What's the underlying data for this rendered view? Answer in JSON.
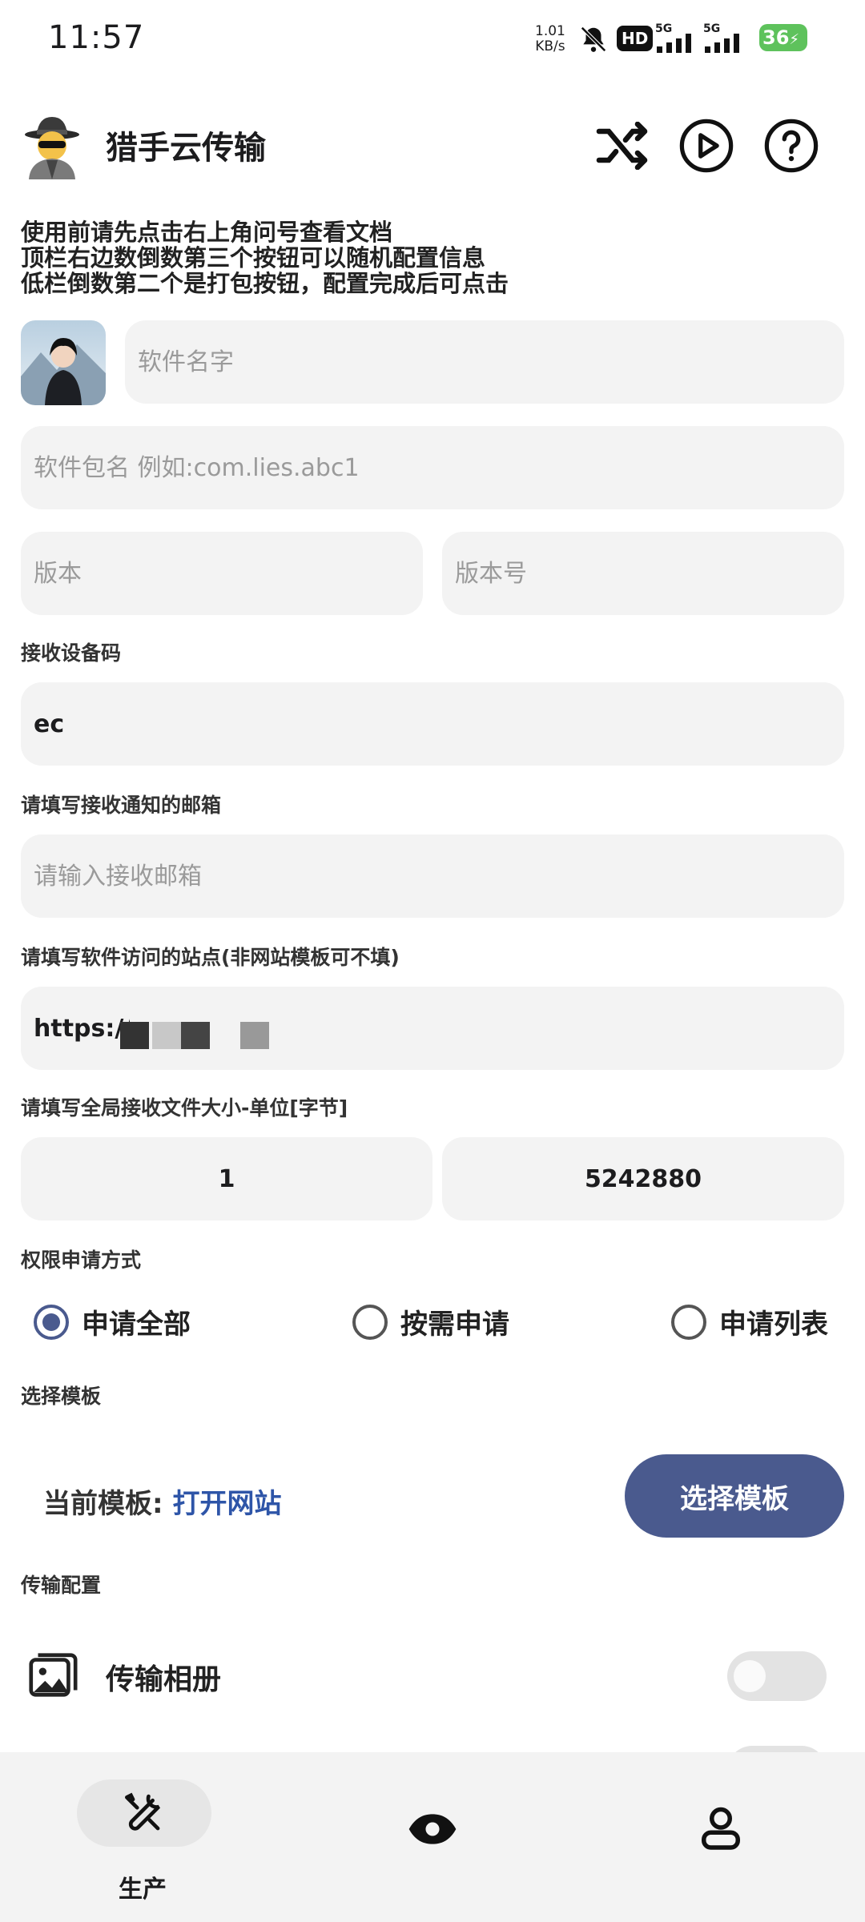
{
  "status": {
    "time": "11:57",
    "net_speed": "1.01",
    "net_unit": "KB/s",
    "hd": "HD",
    "signal1": "5G",
    "signal2": "5G",
    "battery": "36"
  },
  "header": {
    "app_title": "猎手云传输",
    "icons": [
      "spy-avatar-icon",
      "shuffle-icon",
      "play-icon",
      "help-icon"
    ]
  },
  "intro_lines": [
    "使用前请先点击右上角问号查看文档",
    "顶栏右边数倒数第三个按钮可以随机配置信息",
    "低栏倒数第二个是打包按钮，配置完成后可点击"
  ],
  "form": {
    "app_name_placeholder": "软件名字",
    "package_placeholder": "软件包名 例如:com.lies.abc1",
    "version_placeholder": "版本",
    "version_code_placeholder": "版本号",
    "device_code_label": "接收设备码",
    "device_code_value": "ec",
    "email_label": "请填写接收通知的邮箱",
    "email_placeholder": "请输入接收邮箱",
    "site_label": "请填写软件访问的站点(非网站模板可不填)",
    "site_value": "https://w",
    "size_label": "请填写全局接收文件大小-单位[字节]",
    "size_min": "1",
    "size_max": "5242880",
    "permission_label": "权限申请方式",
    "permission_options": [
      "申请全部",
      "按需申请",
      "申请列表"
    ],
    "permission_selected": 0,
    "template_label": "选择模板",
    "current_template_prefix": "当前模板:",
    "current_template_value": "打开网站",
    "choose_template_button": "选择模板",
    "transfer_label": "传输配置",
    "transfer_album": "传输相册"
  },
  "colors": {
    "accent": "#4a5a8e",
    "link": "#2e55a8",
    "field_bg": "#f3f3f3",
    "battery": "#5ec25c"
  },
  "bottom_nav": {
    "items": [
      {
        "icon": "tools-icon",
        "label": "生产"
      },
      {
        "icon": "eye-icon",
        "label": ""
      },
      {
        "icon": "user-icon",
        "label": ""
      }
    ]
  }
}
